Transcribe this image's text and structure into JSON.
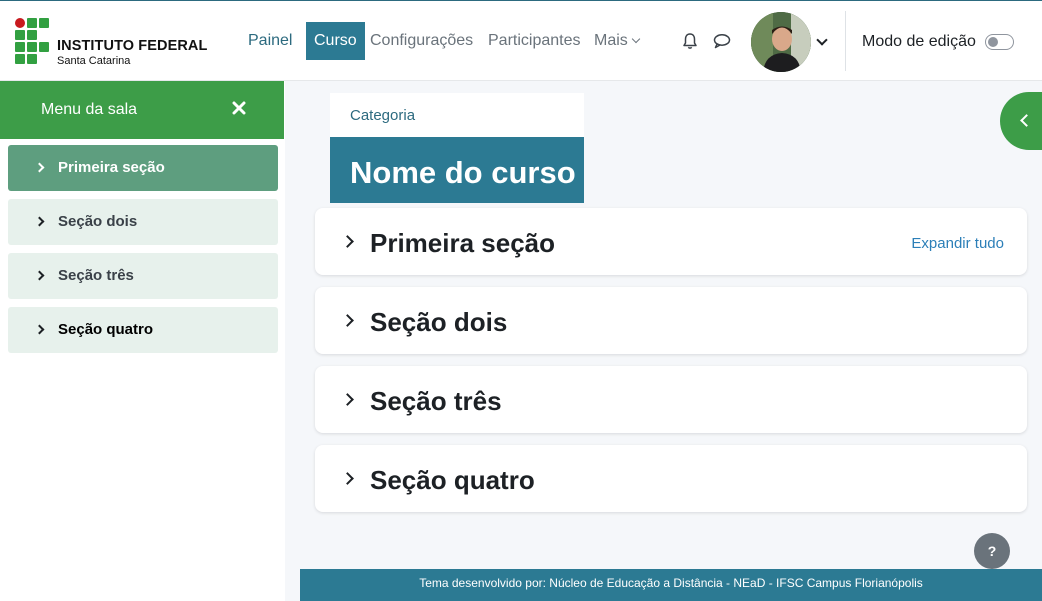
{
  "brand": {
    "title": "INSTITUTO FEDERAL",
    "subtitle": "Santa Catarina",
    "colors": {
      "green": "#32a041",
      "red": "#c8191e"
    }
  },
  "nav": {
    "items": [
      {
        "label": "Painel",
        "state": "default"
      },
      {
        "label": "Curso",
        "state": "active"
      },
      {
        "label": "Configurações",
        "state": "default"
      },
      {
        "label": "Participantes",
        "state": "default"
      },
      {
        "label": "Mais",
        "state": "dropdown"
      }
    ],
    "icons": [
      "bell-icon",
      "chat-bubble-icon"
    ],
    "edit_mode_label": "Modo de edição",
    "edit_mode_on": false
  },
  "drawer": {
    "title": "Menu da sala",
    "items": [
      {
        "label": "Primeira seção",
        "active": true
      },
      {
        "label": "Seção dois",
        "active": false
      },
      {
        "label": "Seção três",
        "active": false
      },
      {
        "label": "Seção quatro",
        "active": false
      }
    ]
  },
  "course": {
    "category": "Categoria",
    "name": "Nome do curso",
    "expand_all": "Expandir tudo",
    "sections": [
      "Primeira seção",
      "Seção dois",
      "Seção três",
      "Seção quatro"
    ]
  },
  "help": {
    "label": "?"
  },
  "footer": {
    "text": "Tema desenvolvido por: Núcleo de Educação a Distância - NEaD - IFSC Campus Florianópolis"
  },
  "colors": {
    "accent": "#2c7a93",
    "drawer_green": "#3d9d48",
    "active_item": "#5e9e7f",
    "item_bg": "#e7f1ec"
  }
}
